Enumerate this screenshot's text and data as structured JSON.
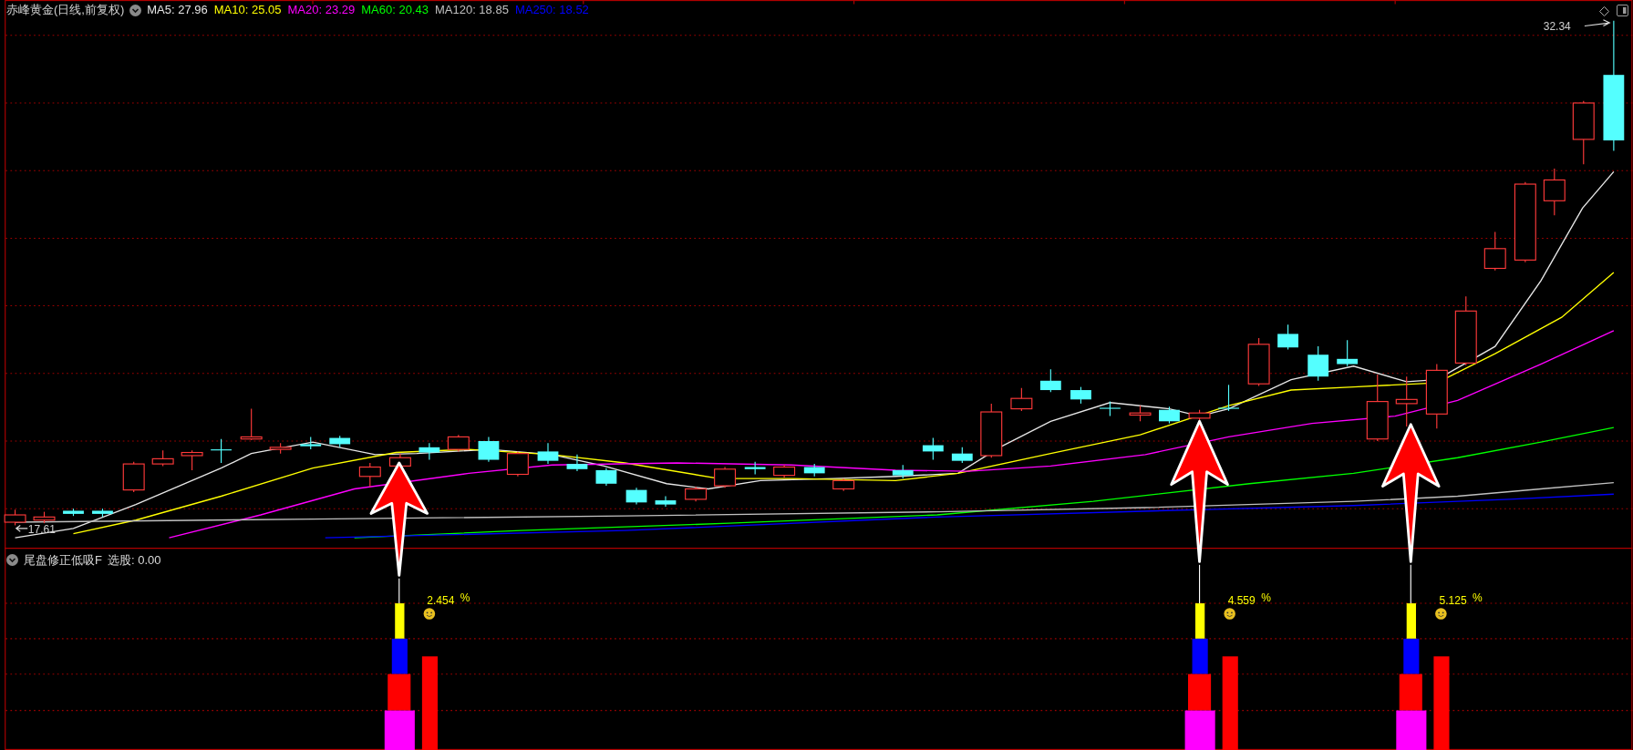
{
  "title": "赤峰黄金(日线,前复权)",
  "ma_legend": [
    {
      "label": "MA5: 27.96",
      "color": "#e6e6e6"
    },
    {
      "label": "MA10: 25.05",
      "color": "#ffff00"
    },
    {
      "label": "MA20: 23.29",
      "color": "#ff00ff"
    },
    {
      "label": "MA60: 20.43",
      "color": "#00ff00"
    },
    {
      "label": "MA120: 18.85",
      "color": "#c0c0c0"
    },
    {
      "label": "MA250: 18.52",
      "color": "#0000ff"
    }
  ],
  "price_labels": {
    "high": "32.34",
    "low": "17.61"
  },
  "indicator": {
    "name": "尾盘修正低吸F",
    "reading": "选股: 0.00"
  },
  "signals": [
    {
      "percent": "2.454",
      "unit": "%"
    },
    {
      "percent": "4.559",
      "unit": "%"
    },
    {
      "percent": "5.125",
      "unit": "%"
    }
  ]
}
